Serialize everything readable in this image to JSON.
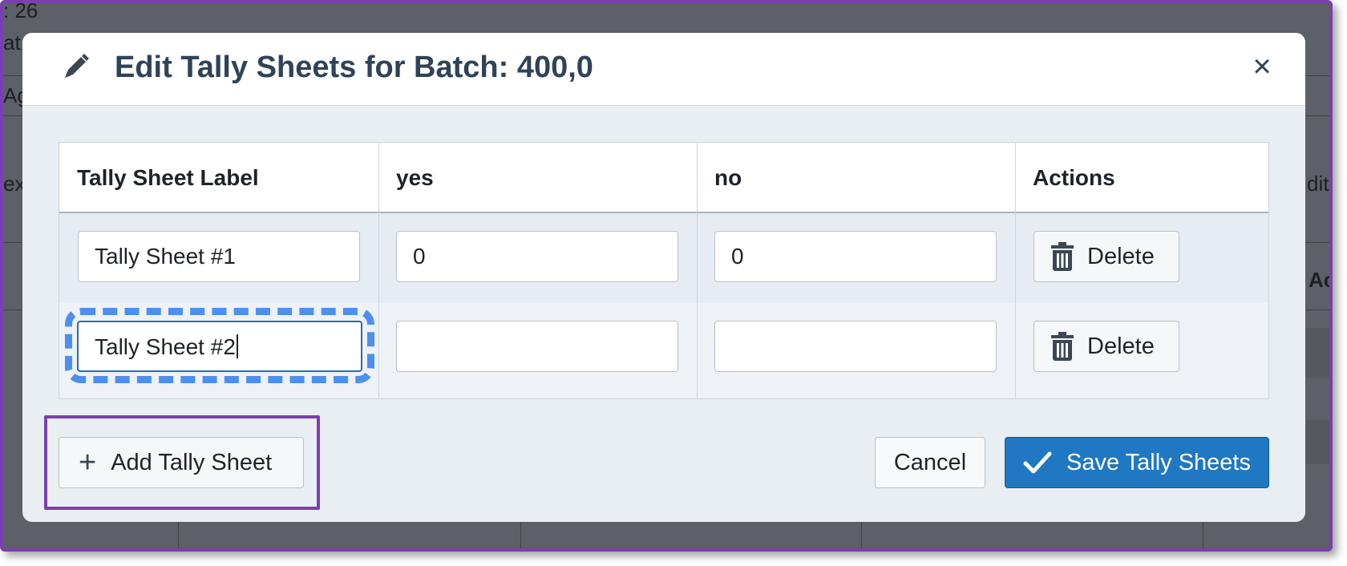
{
  "background": {
    "fragments": [
      ": 26",
      "at",
      "Ag",
      "ex",
      "dit",
      "Ac"
    ]
  },
  "modal": {
    "title": "Edit Tally Sheets for Batch: 400,0",
    "header_icon": "pencil-icon",
    "close_label": "×"
  },
  "table": {
    "columns": [
      "Tally Sheet Label",
      "yes",
      "no",
      "Actions"
    ],
    "rows": [
      {
        "label": "Tally Sheet #1",
        "yes": "0",
        "no": "0",
        "action": "Delete"
      },
      {
        "label": "Tally Sheet #2",
        "yes": "",
        "no": "",
        "action": "Delete"
      }
    ]
  },
  "footer": {
    "add_label": "Add Tally Sheet",
    "cancel_label": "Cancel",
    "save_label": "Save Tally Sheets"
  },
  "colors": {
    "primary": "#1f78c1",
    "focus": "#4d8ff0",
    "highlight": "#7b3fb0",
    "title": "#2f4358"
  }
}
